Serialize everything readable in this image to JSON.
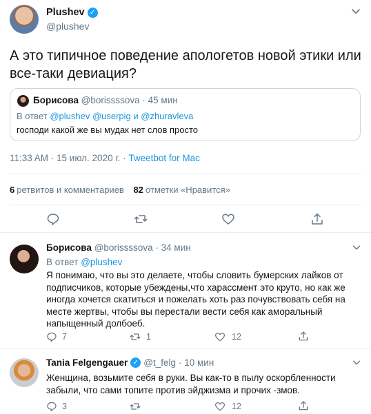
{
  "main_tweet": {
    "author_name": "Plushev",
    "author_handle": "@plushev",
    "text": "А это типичное поведение апологетов новой этики или все-таки девиация?",
    "quote": {
      "author_name": "Борисова",
      "author_handle": "@borissssova",
      "time": "· 45 мин",
      "reply_prefix": "В ответ",
      "reply_to": "@plushev @userpig и @zhuravleva",
      "text": "господи какой же вы мудак нет слов просто"
    },
    "timestamp": "11:33 AM · 15 июл. 2020 г. ·",
    "client": "Tweetbot for Mac",
    "retweets_count": "6",
    "retweets_label": "ретвитов и комментариев",
    "likes_count": "82",
    "likes_label": "отметки «Нравится»"
  },
  "replies": [
    {
      "author_name": "Борисова",
      "author_handle": "@borissssova",
      "time": "· 34 мин",
      "reply_prefix": "В ответ",
      "reply_to": "@plushev",
      "text": "Я понимаю, что вы это делаете, чтобы словить бумерских лайков от подписчиков, которые убеждены,что харассмент это круто, но как же иногда хочется скатиться и пожелать хоть раз почувствовать себя на месте жертвы, чтобы вы перестали вести себя как аморальный напыщенный долбоеб.",
      "reply_count": "7",
      "retweet_count": "1",
      "like_count": "12"
    },
    {
      "author_name": "Tania Felgengauer",
      "author_handle": "@t_felg",
      "time": "· 10 мин",
      "text": "Женщина, возьмите себя в руки. Вы как-то в пылу оскорбленности забыли, что сами топите против эйджизма и прочих -змов.",
      "reply_count": "3",
      "retweet_count": "",
      "like_count": "12"
    }
  ],
  "icons": [
    "verified-icon",
    "chevron-down-icon",
    "reply-icon",
    "retweet-icon",
    "like-icon",
    "share-icon"
  ],
  "colors": {
    "accent": "#1b95e0",
    "muted": "#657786",
    "text": "#14171a",
    "border": "#e6ecf0",
    "verified": "#1da1f2"
  }
}
